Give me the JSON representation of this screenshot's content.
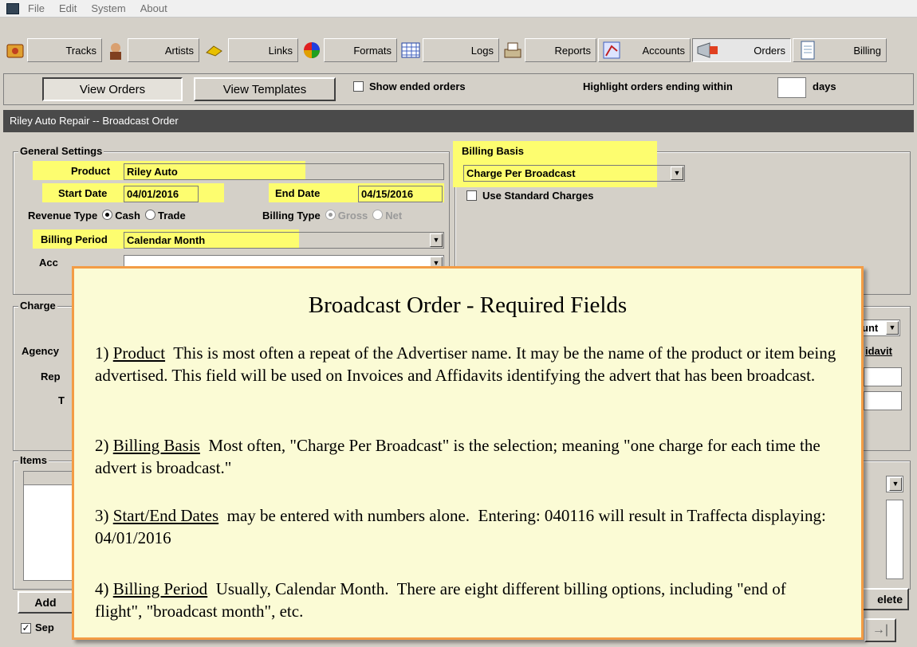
{
  "menu": [
    "File",
    "Edit",
    "System",
    "About"
  ],
  "toolbar": {
    "tracks": "Tracks",
    "artists": "Artists",
    "links": "Links",
    "formats": "Formats",
    "logs": "Logs",
    "reports": "Reports",
    "accounts": "Accounts",
    "orders": "Orders",
    "billing": "Billing"
  },
  "subbar": {
    "view_orders": "View Orders",
    "view_templates": "View Templates",
    "show_ended": "Show ended orders",
    "highlight_prefix": "Highlight orders ending within",
    "highlight_value": "",
    "highlight_suffix": "days"
  },
  "window_title": "Riley Auto Repair -- Broadcast Order",
  "general": {
    "title": "General Settings",
    "product_label": "Product",
    "product_value": "Riley Auto",
    "start_label": "Start Date",
    "start_value": "04/01/2016",
    "end_label": "End Date",
    "end_value": "04/15/2016",
    "revenue_label": "Revenue Type",
    "cash": "Cash",
    "trade": "Trade",
    "billing_type_label": "Billing Type",
    "gross": "Gross",
    "net": "Net",
    "billing_period_label": "Billing Period",
    "billing_period_value": "Calendar Month",
    "account_label_partial": "Acc"
  },
  "billing_basis": {
    "title": "Billing Basis",
    "value": "Charge Per Broadcast",
    "use_standard": "Use Standard Charges"
  },
  "charges": {
    "title_partial": "Charge",
    "agency_partial": "Agency",
    "rep_partial": "Rep",
    "t_partial": "T",
    "right_dropdown_partial": "unt",
    "right_label_partial": "idavit"
  },
  "items": {
    "title_partial": "Items",
    "add": "Add",
    "delete_partial": "elete",
    "sep_partial": "Sep"
  },
  "callout": {
    "title": "Broadcast Order - Required Fields",
    "p1_num": "1) ",
    "p1_term": "Product",
    "p1_text": "  This is most often a repeat of the Advertiser name. It may be the name of the product or item being advertised. This field will be used on Invoices and Affidavits identifying the advert that has been broadcast.",
    "p2_num": "2) ",
    "p2_term": "Billing Basis",
    "p2_text": "  Most often, \"Charge Per Broadcast\" is the selection; meaning \"one charge for each time the advert is broadcast.\"",
    "p3_num": "3) ",
    "p3_term": "Start/End Dates",
    "p3_text": "  may be entered with numbers alone.  Entering: 040116 will result in Traffecta displaying:  04/01/2016",
    "p4_num": "4) ",
    "p4_term": "Billing Period",
    "p4_text": "  Usually, Calendar Month.  There are eight different billing options, including \"end of flight\", \"broadcast month\", etc."
  },
  "colors": {
    "highlight": "#fdfd6f",
    "callout_bg": "#fbfbd5",
    "callout_border": "#f39c45",
    "titlebar": "#4a4a4a"
  }
}
